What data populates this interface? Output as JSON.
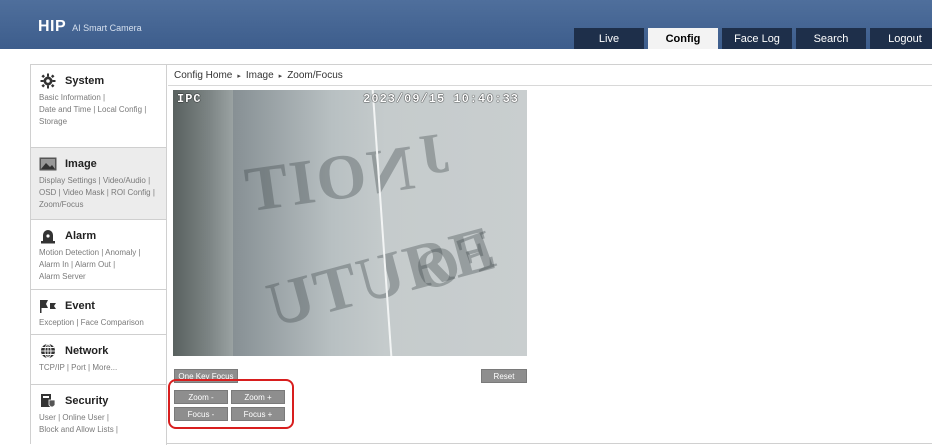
{
  "header": {
    "logo": "HIP",
    "subtitle": "AI Smart Camera",
    "tabs": [
      {
        "label": "Live"
      },
      {
        "label": "Config"
      },
      {
        "label": "Face Log"
      },
      {
        "label": "Search"
      },
      {
        "label": "Logout"
      }
    ],
    "active_tab": "Config"
  },
  "sidebar": {
    "sections": [
      {
        "title": "System",
        "icon": "gear-icon",
        "links": [
          "Basic Information |",
          "Date and Time | Local Config |",
          "Storage"
        ]
      },
      {
        "title": "Image",
        "icon": "image-icon",
        "links": [
          "Display Settings | Video/Audio |",
          "OSD | Video Mask | ROI Config |",
          "Zoom/Focus"
        ]
      },
      {
        "title": "Alarm",
        "icon": "alarm-icon",
        "links": [
          "Motion Detection | Anomaly |",
          "Alarm In | Alarm Out |",
          "Alarm Server"
        ]
      },
      {
        "title": "Event",
        "icon": "event-icon",
        "links": [
          "Exception | Face Comparison"
        ]
      },
      {
        "title": "Network",
        "icon": "globe-icon",
        "links": [
          "TCP/IP | Port | More..."
        ]
      },
      {
        "title": "Security",
        "icon": "security-icon",
        "links": [
          "User | Online User |",
          "Block and Allow Lists |"
        ]
      }
    ]
  },
  "breadcrumb": {
    "items": [
      "Config Home",
      "Image",
      "Zoom/Focus"
    ],
    "separator": "▸"
  },
  "video": {
    "osd_left": "IPC",
    "osd_right": "2023/09/15 10:40:33"
  },
  "controls": {
    "one_key_focus": "One Key Focus",
    "reset": "Reset",
    "zoom_minus": "Zoom -",
    "zoom_plus": "Zoom +",
    "focus_minus": "Focus -",
    "focus_plus": "Focus +"
  },
  "colors": {
    "header_bg": "#4a6a98",
    "tab_bg": "#1e2f4a",
    "highlight": "#d81e1e",
    "button_bg": "#8e8e8e"
  }
}
